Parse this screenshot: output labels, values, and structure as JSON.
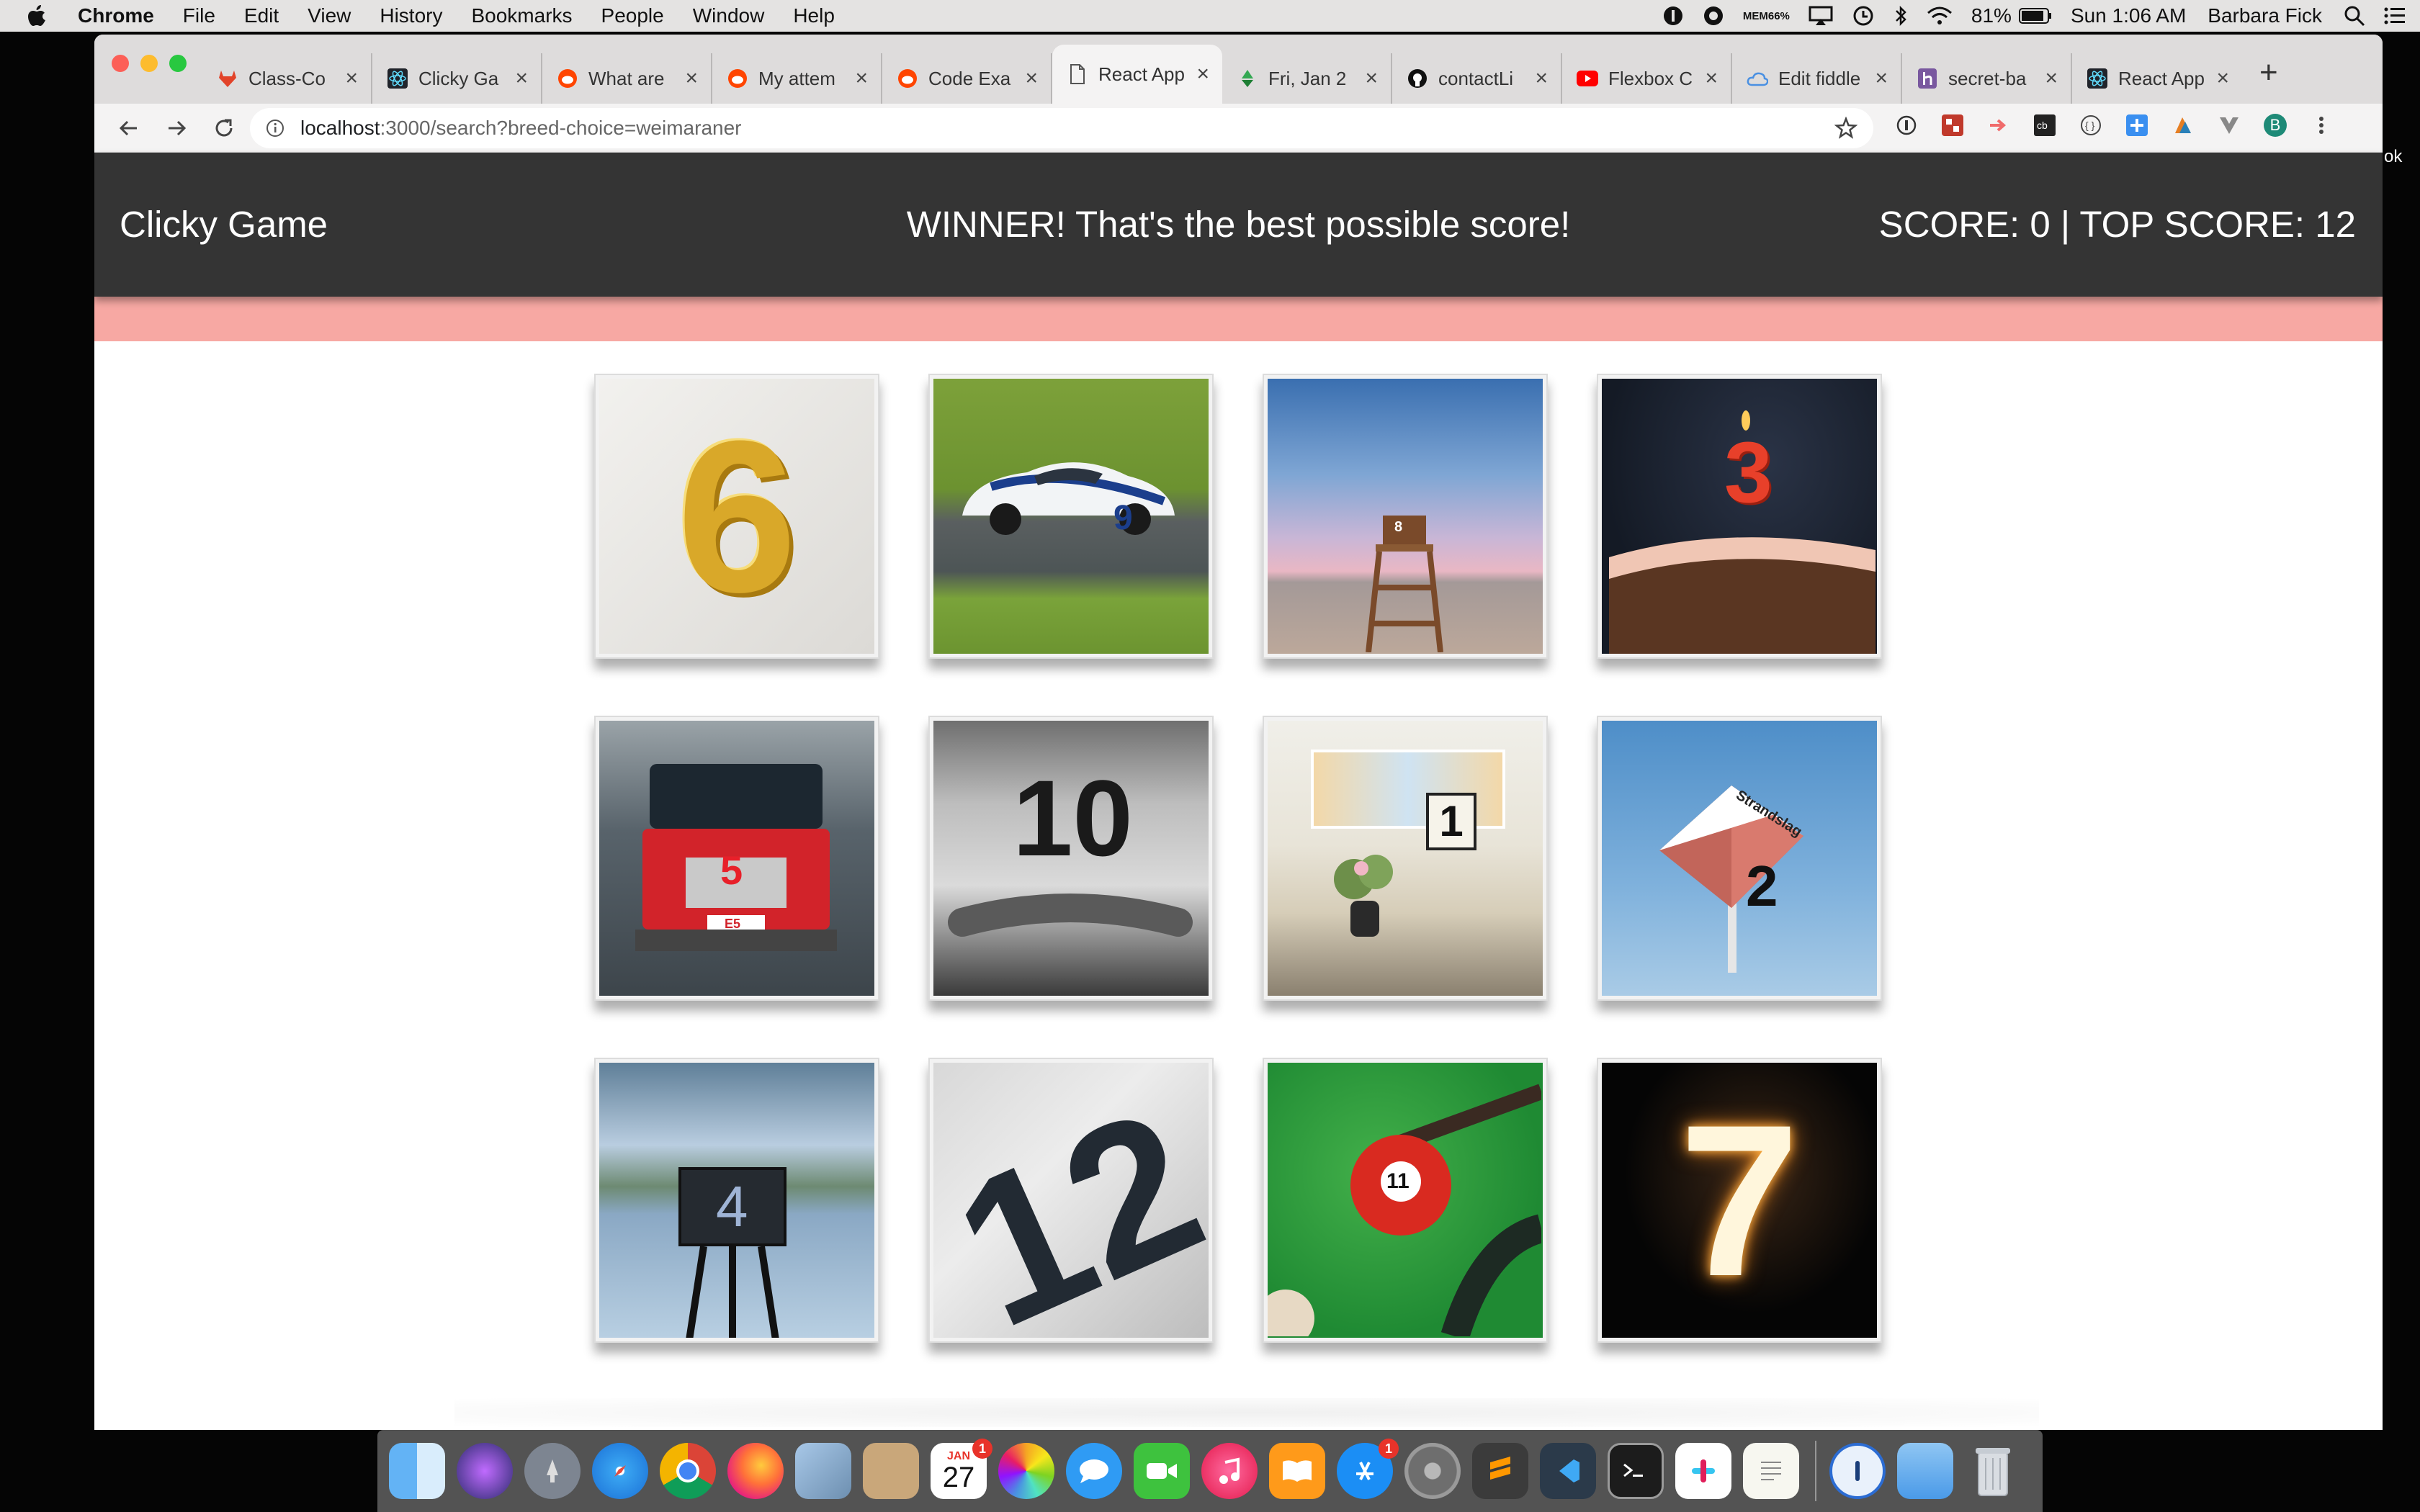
{
  "menubar": {
    "app": "Chrome",
    "items": [
      "File",
      "Edit",
      "View",
      "History",
      "Bookmarks",
      "People",
      "Window",
      "Help"
    ],
    "mem_label": "MEM",
    "mem_value": "66%",
    "battery": "81%",
    "clock": "Sun 1:06 AM",
    "user": "Barbara Fick"
  },
  "tabs": [
    {
      "title": "Class-Co",
      "icon": "gitlab-icon",
      "color": "#e24329"
    },
    {
      "title": "Clicky Ga",
      "icon": "react-icon",
      "color": "#61dafb"
    },
    {
      "title": "What are",
      "icon": "reddit-icon",
      "color": "#ff4500"
    },
    {
      "title": "My attem",
      "icon": "reddit-icon",
      "color": "#ff4500"
    },
    {
      "title": "Code Exa",
      "icon": "reddit-icon",
      "color": "#ff4500"
    },
    {
      "title": "React App",
      "icon": "document-icon",
      "color": "#777777",
      "active": true
    },
    {
      "title": "Fri, Jan 2",
      "icon": "recycle-icon",
      "color": "#34a853"
    },
    {
      "title": "contactLi",
      "icon": "github-icon",
      "color": "#111111"
    },
    {
      "title": "Flexbox C",
      "icon": "youtube-icon",
      "color": "#ff0000"
    },
    {
      "title": "Edit fiddle",
      "icon": "cloud-icon",
      "color": "#4a90e2"
    },
    {
      "title": "secret-ba",
      "icon": "heroku-icon",
      "color": "#79589f"
    },
    {
      "title": "React App",
      "icon": "react-icon",
      "color": "#61dafb"
    }
  ],
  "address": {
    "host": "localhost",
    "rest": ":3000/search?breed-choice=weimaraner"
  },
  "app": {
    "brand": "Clicky Game",
    "message": "WINNER! That's the best possible score!",
    "score_text": "SCORE: 0 | TOP SCORE: 12"
  },
  "cards": [
    {
      "label": "6",
      "subject": "gold-balloon-six"
    },
    {
      "label": "9",
      "subject": "race-car-nine"
    },
    {
      "label": "8",
      "subject": "lifeguard-tower-eight"
    },
    {
      "label": "3",
      "subject": "birthday-cake-three"
    },
    {
      "label": "5",
      "subject": "fire-truck-five"
    },
    {
      "label": "10",
      "subject": "jersey-ten"
    },
    {
      "label": "1",
      "subject": "window-sign-one"
    },
    {
      "label": "2",
      "subject": "strandslag-sign-two"
    },
    {
      "label": "4",
      "subject": "lake-sign-four"
    },
    {
      "label": "12",
      "subject": "race-number-twelve"
    },
    {
      "label": "11",
      "subject": "billiard-ball-eleven"
    },
    {
      "label": "7",
      "subject": "sparkler-seven"
    }
  ],
  "overlays": {
    "strandslag": "Strandslag",
    "truck_plate": "E5",
    "edge_text": "ok"
  },
  "dock": {
    "calendar_month": "JAN",
    "calendar_day": "27",
    "calendar_badge": "1",
    "appstore_badge": "1"
  },
  "colors": {
    "navbar": "#343434",
    "accent_bar": "#f7a8a3",
    "profile": "#1e8a77"
  }
}
